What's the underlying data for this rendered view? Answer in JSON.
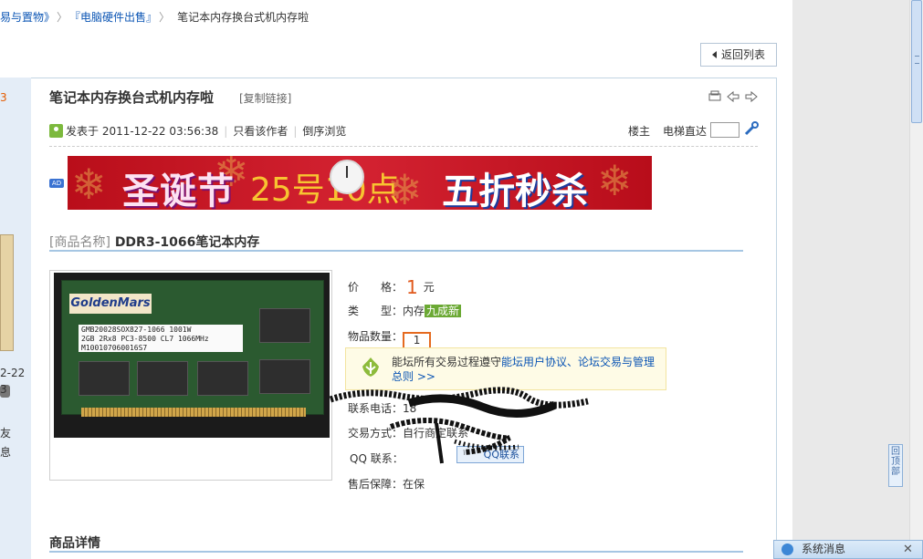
{
  "breadcrumb": {
    "items": [
      "易与置物》",
      "『电脑硬件出售』",
      "笔记本内存换台式机内存啦"
    ],
    "sep": "〉"
  },
  "back_button": "返回列表",
  "sidebar": {
    "num": "3",
    "date1": "2-22",
    "date2": "3",
    "text1": "友",
    "text2": "息"
  },
  "thread": {
    "title": "笔记本内存换台式机内存啦",
    "copy_link": "[复制链接]"
  },
  "post_meta": {
    "posted": "发表于 2011-12-22 03:56:38",
    "only_author": "只看该作者",
    "reverse": "倒序浏览",
    "floor": "楼主",
    "elevator": "电梯直达"
  },
  "ad": {
    "badge": "AD",
    "text1": "圣诞节",
    "text2": "25号10点",
    "text3": "五折秒杀"
  },
  "product": {
    "name_label": "[商品名称]",
    "name": "DDR3-1066笔记本内存",
    "price_label": "价　　格：",
    "price": "1",
    "price_unit": "元",
    "type_label": "类　　型：",
    "type": "内存",
    "condition": "九成新",
    "qty_label": "物品数量：",
    "qty": "1",
    "contact_label": "联系电话：",
    "contact": "18",
    "trade_label": "交易方式：",
    "trade": "自行商定联系",
    "qq_label": "QQ 联系：",
    "qq_button": "QQ联系",
    "after_label": "售后保障：",
    "after": "在保"
  },
  "photo": {
    "brand": "GoldenMars",
    "label_line1": "GMB20028SOX827-1066       1001W",
    "label_line2": "2GB 2Rx8 PC3-8500 CL7 1066MHz",
    "label_line3": "M100107060016S7"
  },
  "notice": {
    "text_prefix": "能坛所有交易过程遵守",
    "link": "能坛用户协议、论坛交易与管理总则 >>"
  },
  "detail_title": "商品详情",
  "back_top": "回顶部",
  "sys_msg": {
    "label": "系统消息",
    "close": "✕"
  },
  "colors": {
    "accent_blue": "#a6c6e3",
    "price_orange": "#e0581b",
    "condition_green": "#6ba934",
    "link_blue": "#0b55b4"
  }
}
